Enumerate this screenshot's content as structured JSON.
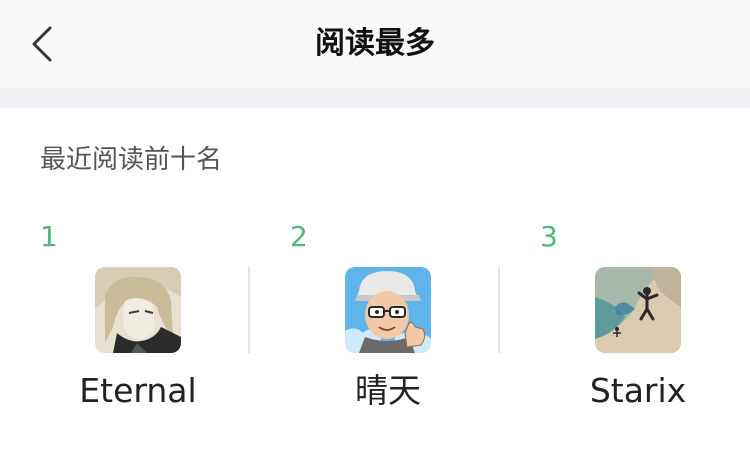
{
  "header": {
    "title": "阅读最多",
    "back_icon": "chevron-left-icon"
  },
  "section": {
    "title": "最近阅读前十名"
  },
  "ranking": [
    {
      "rank": "1",
      "name": "Eternal",
      "avatar": "anime-character-avatar"
    },
    {
      "rank": "2",
      "name": "晴天",
      "avatar": "cartoon-man-thumbs-up-avatar"
    },
    {
      "rank": "3",
      "name": "Starix",
      "avatar": "skydiver-aerial-avatar"
    }
  ],
  "colors": {
    "accent": "#4cb97a",
    "nav_bg": "#f8f8f8",
    "divider": "#efeff4"
  }
}
